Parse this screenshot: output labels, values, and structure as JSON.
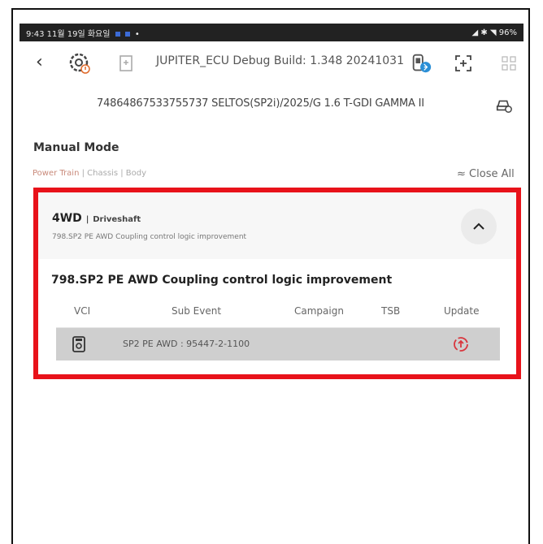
{
  "status_bar": {
    "left": "9:43 11월 19일 화요일",
    "right": "96%"
  },
  "top_bar": {
    "title": "JUPITER_ECU Debug Build: 1.348 20241031"
  },
  "vehicle": {
    "info": "74864867533755737 SELTOS(SP2i)/2025/G 1.6 T-GDI GAMMA II"
  },
  "mode_title": "Manual Mode",
  "categories": [
    "Power Train",
    "Chassis",
    "Body"
  ],
  "category_separator": "|",
  "close_all": "Close All",
  "card": {
    "system": "4WD",
    "separator": "|",
    "subsystem": "Driveshaft",
    "summary": "798.SP2 PE AWD Coupling control logic improvement",
    "heading": "798.SP2 PE AWD Coupling control logic improvement",
    "columns": [
      "VCI",
      "Sub Event",
      "Campaign",
      "TSB",
      "Update"
    ],
    "rows": [
      {
        "sub_event": "SP2 PE AWD : 95447-2-1100"
      }
    ]
  },
  "colors": {
    "highlight": "#e8121a",
    "update_icon": "#d9363e"
  }
}
